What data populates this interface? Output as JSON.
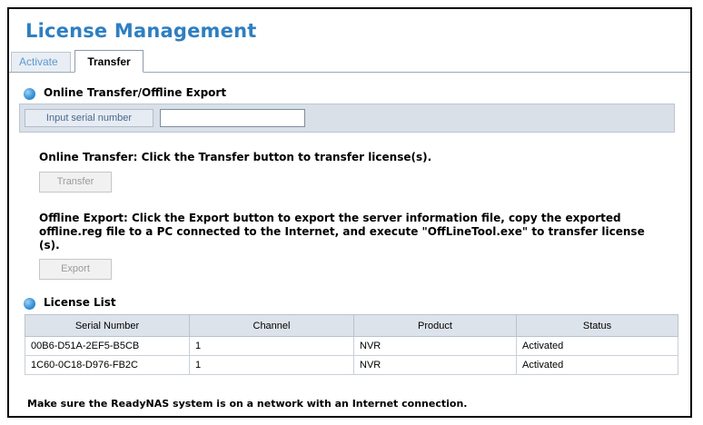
{
  "page": {
    "title": "License Management"
  },
  "tabs": [
    {
      "label": "Activate"
    },
    {
      "label": "Transfer"
    }
  ],
  "transfer_section": {
    "title": "Online Transfer/Offline Export",
    "serial_label": "Input serial number",
    "serial_value": "",
    "online_text": "Online Transfer: Click the Transfer button to transfer license(s).",
    "transfer_button": "Transfer",
    "offline_text_line1": "Offline Export: Click the Export button to export the server information file, copy the exported",
    "offline_text_line2": "offline.reg file to a PC connected to the Internet, and execute \"OffLineTool.exe\" to transfer license",
    "offline_text_line3": "(s).",
    "export_button": "Export"
  },
  "license_list": {
    "title": "License List",
    "columns": [
      "Serial Number",
      "Channel",
      "Product",
      "Status"
    ],
    "rows": [
      [
        "00B6-D51A-2EF5-B5CB",
        "1",
        "NVR",
        "Activated"
      ],
      [
        "1C60-0C18-D976-FB2C",
        "1",
        "NVR",
        "Activated"
      ]
    ]
  },
  "footer": "Make sure the ReadyNAS system is on a network with an Internet connection."
}
